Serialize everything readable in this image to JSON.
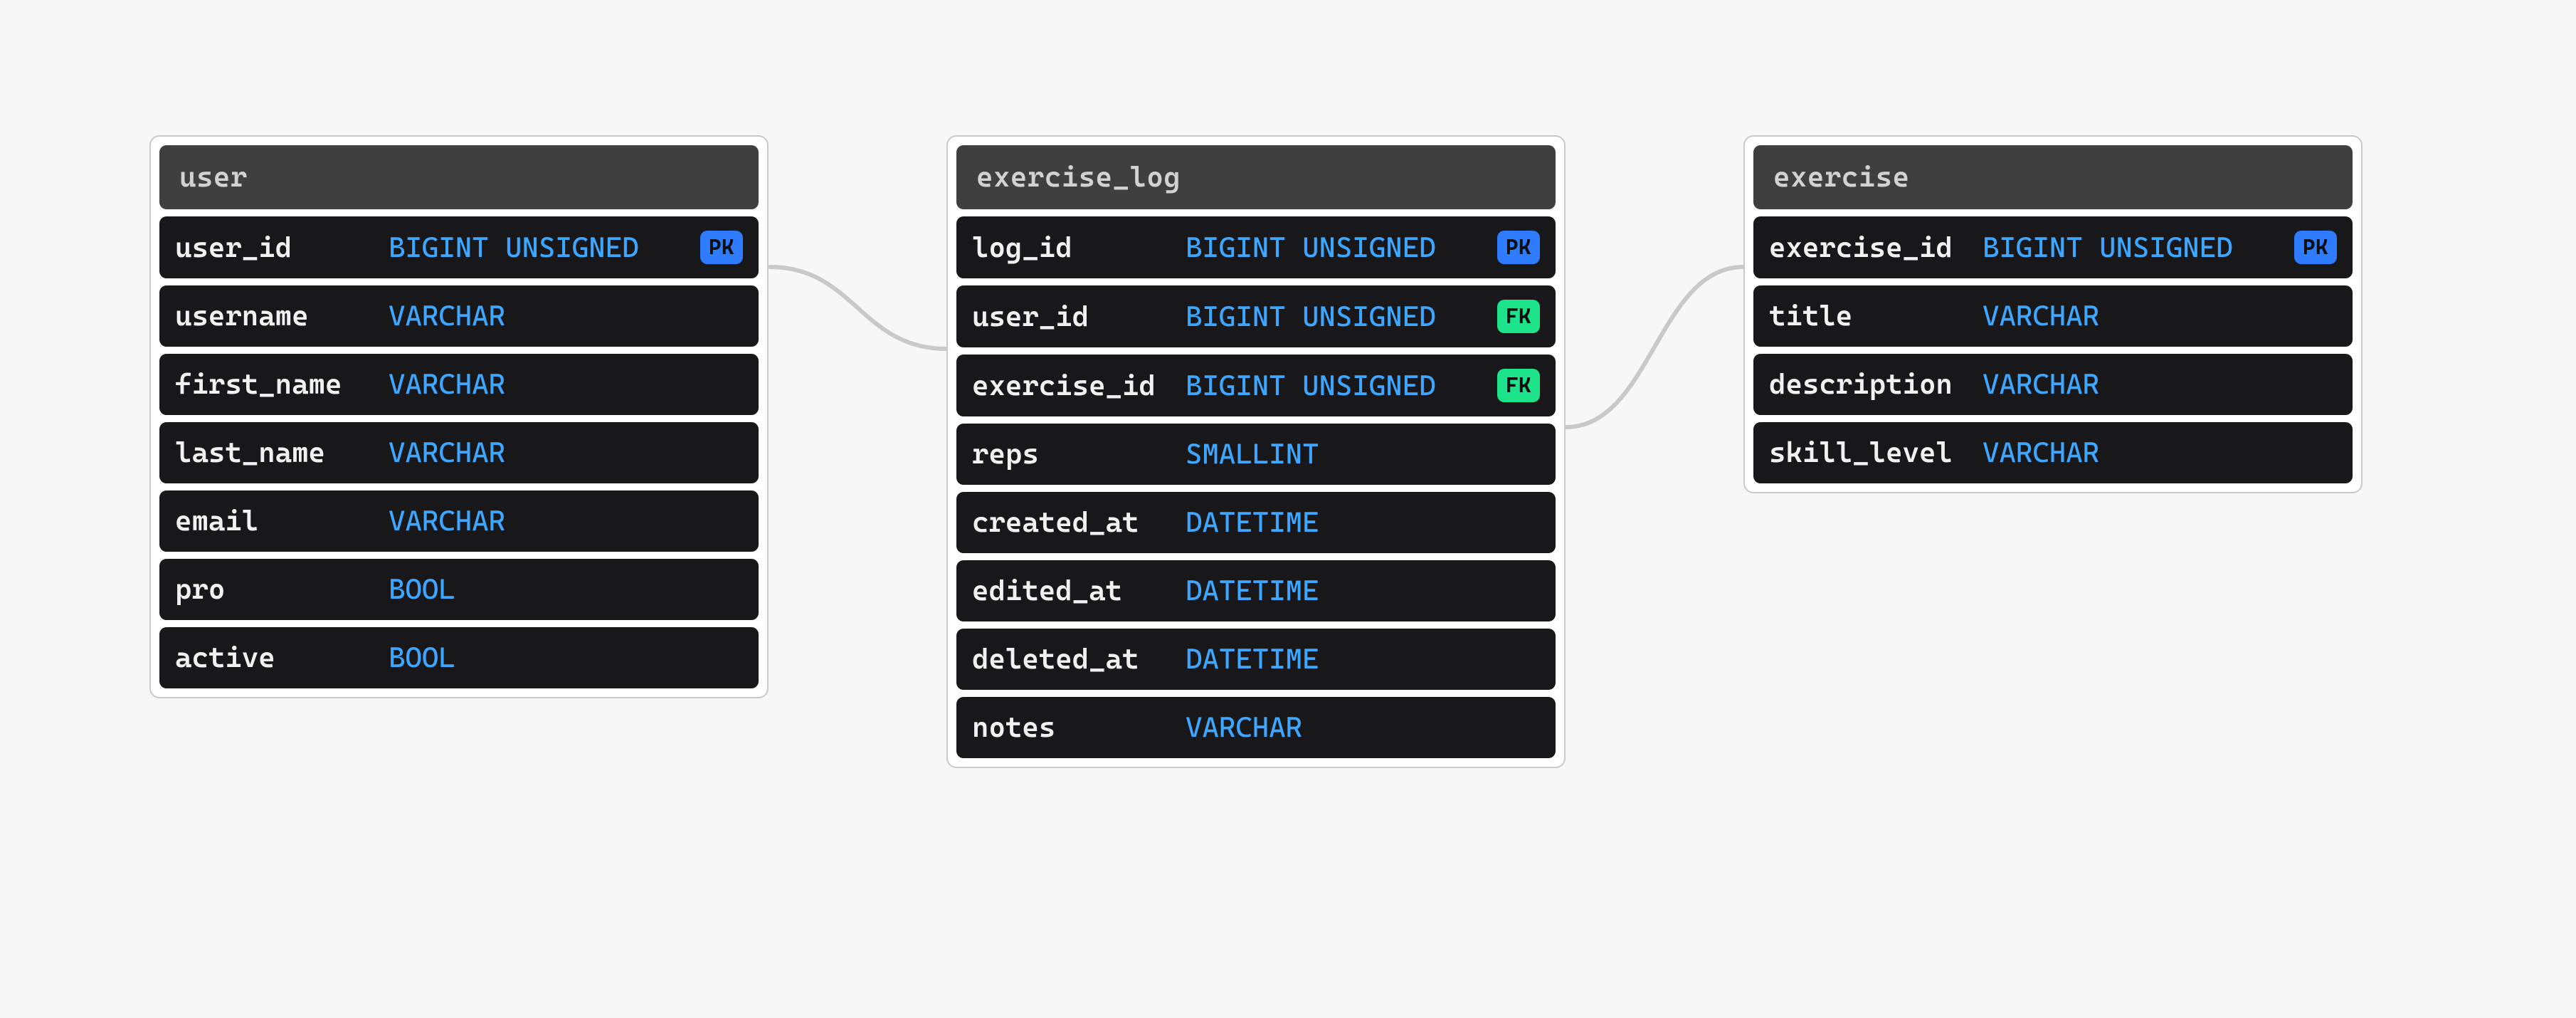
{
  "diagram": {
    "tables": [
      {
        "id": "user",
        "title": "user",
        "columns": [
          {
            "name": "user_id",
            "type": "BIGINT UNSIGNED",
            "key": "PK"
          },
          {
            "name": "username",
            "type": "VARCHAR"
          },
          {
            "name": "first_name",
            "type": "VARCHAR"
          },
          {
            "name": "last_name",
            "type": "VARCHAR"
          },
          {
            "name": "email",
            "type": "VARCHAR"
          },
          {
            "name": "pro",
            "type": "BOOL"
          },
          {
            "name": "active",
            "type": "BOOL"
          }
        ]
      },
      {
        "id": "exercise_log",
        "title": "exercise_log",
        "columns": [
          {
            "name": "log_id",
            "type": "BIGINT UNSIGNED",
            "key": "PK"
          },
          {
            "name": "user_id",
            "type": "BIGINT UNSIGNED",
            "key": "FK"
          },
          {
            "name": "exercise_id",
            "type": "BIGINT UNSIGNED",
            "key": "FK"
          },
          {
            "name": "reps",
            "type": "SMALLINT"
          },
          {
            "name": "created_at",
            "type": "DATETIME"
          },
          {
            "name": "edited_at",
            "type": "DATETIME"
          },
          {
            "name": "deleted_at",
            "type": "DATETIME"
          },
          {
            "name": "notes",
            "type": "VARCHAR"
          }
        ]
      },
      {
        "id": "exercise",
        "title": "exercise",
        "columns": [
          {
            "name": "exercise_id",
            "type": "BIGINT UNSIGNED",
            "key": "PK"
          },
          {
            "name": "title",
            "type": "VARCHAR"
          },
          {
            "name": "description",
            "type": "VARCHAR"
          },
          {
            "name": "skill_level",
            "type": "VARCHAR"
          }
        ]
      }
    ],
    "relations": [
      {
        "from_table": "user",
        "from_column": "user_id",
        "to_table": "exercise_log",
        "to_column": "user_id"
      },
      {
        "from_table": "exercise",
        "from_column": "exercise_id",
        "to_table": "exercise_log",
        "to_column": "exercise_id"
      }
    ],
    "colors": {
      "pk_badge": "#2e7bff",
      "fk_badge": "#1de38a",
      "type_text": "#3ea6ff",
      "row_bg": "#18181b",
      "header_bg": "#3f3f3f",
      "canvas_bg": "#f7f7f7"
    }
  }
}
